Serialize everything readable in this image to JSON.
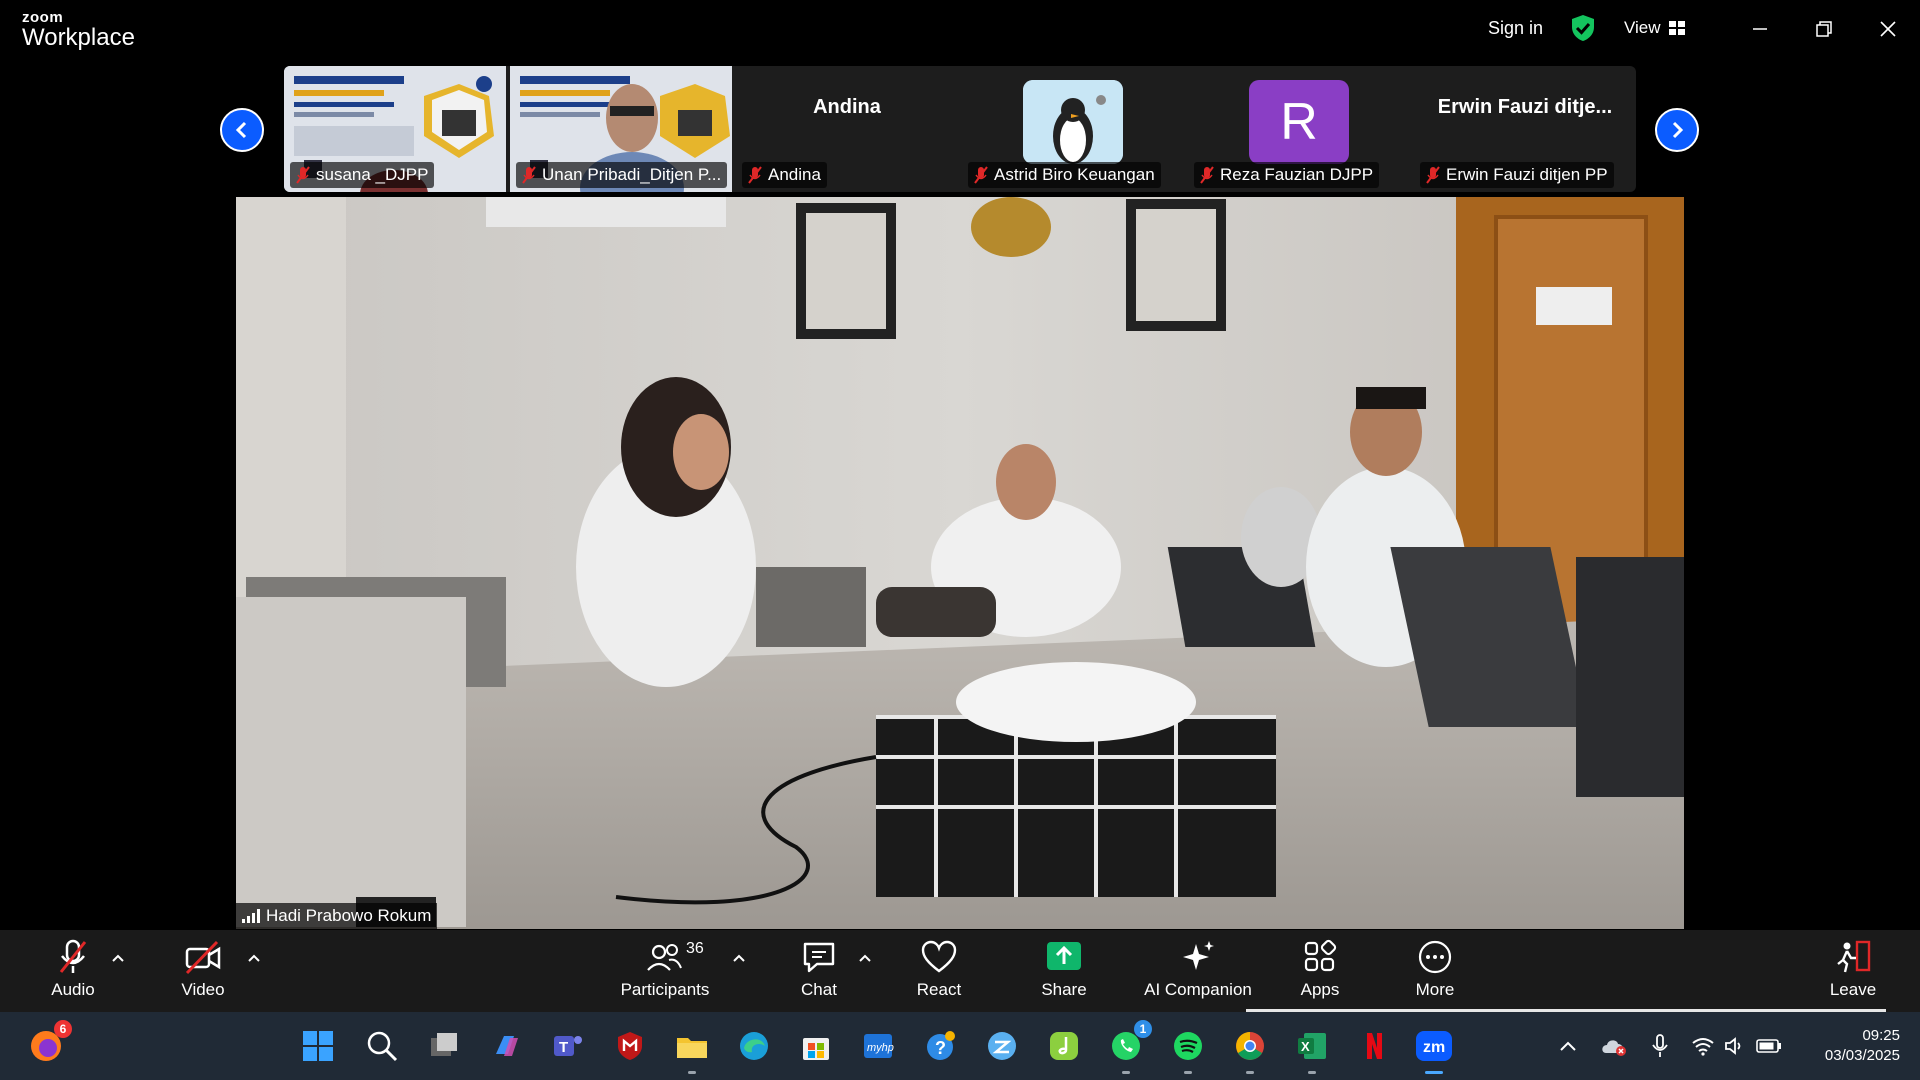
{
  "titlebar": {
    "brand_top": "zoom",
    "brand_bottom": "Workplace",
    "sign_in": "Sign in",
    "view": "View"
  },
  "participants_strip": [
    {
      "name": "susana _DJPP",
      "muted": true,
      "video": "poster"
    },
    {
      "name": "Unan Pribadi_Ditjen P...",
      "muted": true,
      "video": "poster-person"
    },
    {
      "name": "Andina",
      "label": "Andina",
      "muted": true,
      "video": "none"
    },
    {
      "name": "Astrid Biro Keuangan",
      "muted": true,
      "video": "penguin-avatar"
    },
    {
      "name": "Reza Fauzian DJPP",
      "muted": true,
      "video": "letter-avatar",
      "letter": "R",
      "color": "#8a3ec5"
    },
    {
      "name": "Erwin Fauzi ditjen PP",
      "label": "Erwin Fauzi ditje...",
      "muted": true,
      "video": "none"
    }
  ],
  "main_video": {
    "speaker": "Hadi Prabowo Rokum"
  },
  "toolbar": {
    "audio": "Audio",
    "video": "Video",
    "participants": "Participants",
    "participants_count": "36",
    "chat": "Chat",
    "react": "React",
    "share": "Share",
    "ai_companion": "AI Companion",
    "apps": "Apps",
    "more": "More",
    "leave": "Leave"
  },
  "taskbar": {
    "firefox_badge": "6",
    "whatsapp_badge": "1",
    "time": "09:25",
    "date": "03/03/2025"
  },
  "colors": {
    "accent": "#0b5cff",
    "share_green": "#0fb66b",
    "muted_red": "#e02828"
  }
}
